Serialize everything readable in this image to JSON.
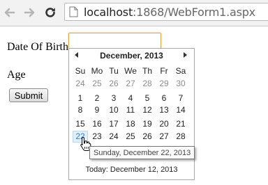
{
  "browser": {
    "url_host": "localhost",
    "url_path": ":1868/WebForm1.aspx"
  },
  "form": {
    "dob_label": "Date Of Birth",
    "age_label": "Age",
    "submit_label": "Submit",
    "dob_value": ""
  },
  "calendar": {
    "title": "December, 2013",
    "weekdays": [
      "Su",
      "Mo",
      "Tu",
      "We",
      "Th",
      "Fr",
      "Sa"
    ],
    "weeks": [
      [
        "24",
        "25",
        "26",
        "27",
        "28",
        "29",
        "30"
      ],
      [
        "1",
        "2",
        "3",
        "4",
        "5",
        "6",
        "7"
      ],
      [
        "8",
        "9",
        "10",
        "11",
        "12",
        "13",
        "14"
      ],
      [
        "15",
        "16",
        "17",
        "18",
        "19",
        "20",
        "21"
      ],
      [
        "22",
        "23",
        "24",
        "25",
        "26",
        "27",
        "28"
      ]
    ],
    "today_label": "Today: December 12, 2013",
    "hover_tooltip": "Sunday, December 22, 2013"
  }
}
